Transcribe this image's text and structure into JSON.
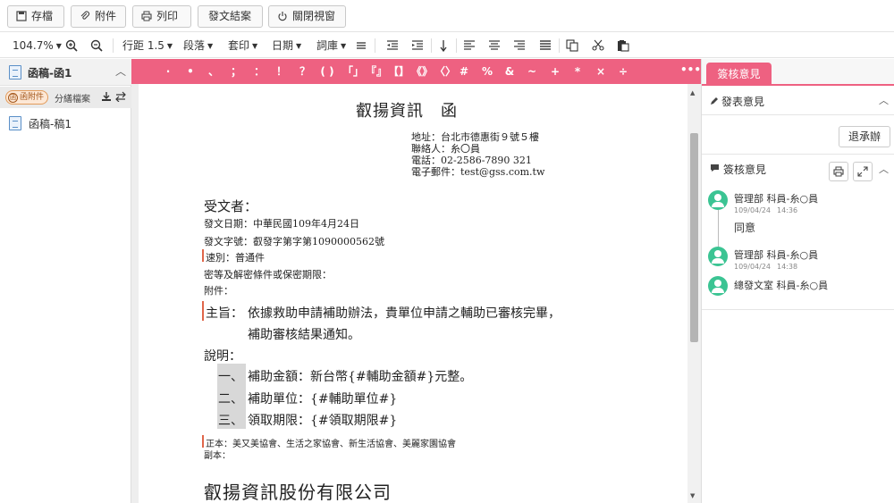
{
  "topbar": {
    "save": "存檔",
    "attach": "附件",
    "print": "列印",
    "send_result": "發文結案",
    "close_window": "關閉視窗"
  },
  "toolbar": {
    "zoom": "104.7%",
    "line_spacing": "行距 1.5",
    "paragraph": "段落",
    "template": "套印",
    "date": "日期",
    "phrases": "詞庫"
  },
  "left_panel": {
    "header": "函稿-函1",
    "attachment_badge": "函附件",
    "split_files": "分繕檔案",
    "draft_item": "函稿-稿1"
  },
  "symbols": [
    "·",
    "•",
    "、",
    "；",
    "：",
    "！",
    "？",
    "( )",
    "「」",
    "『』",
    "【】",
    "《》",
    "〈〉",
    "#",
    "%",
    "&",
    "~",
    "+",
    "*",
    "×",
    "÷"
  ],
  "document": {
    "title": "叡揚資訊　函",
    "address": "地址：台北市德惠街９號５樓",
    "contact": "聯絡人：糸〇員",
    "phone": "電話：02-2586-7890 321",
    "email": "電子郵件：test@gss.com.tw",
    "recipient": "受文者：",
    "send_date": "發文日期：中華民國109年4月24日",
    "send_number": "發文字號：叡發字第字第1090000562號",
    "speed": "速別：普通件",
    "security": "密等及解密條件或保密期限：",
    "attachment": "附件：",
    "subject_label": "主旨：",
    "subject_line1": "依據救助申請補助辦法，貴單位申請之輔助已審核完畢，",
    "subject_line2": "補助審核結果通知。",
    "explain_label": "說明：",
    "items": [
      {
        "num": "一、",
        "text": "補助金額：新台幣{#輔助金額#}元整。"
      },
      {
        "num": "二、",
        "text": "補助單位：{#輔助單位#}"
      },
      {
        "num": "三、",
        "text": "領取期限：{#領取期限#}"
      }
    ],
    "original_copy": "正本：美又美協會、生活之家協會、新生活協會、美麗家園協會",
    "carbon_copy": "副本：",
    "signature": "叡揚資訊股份有限公司"
  },
  "right_panel": {
    "tab": "簽核意見",
    "publish_section": "發表意見",
    "return_button": "退承辦",
    "review_section": "簽核意見",
    "comments": [
      {
        "dept": "管理部 科員-糸○員",
        "date": "109/04/24",
        "time": "14:36",
        "text": "同意"
      },
      {
        "dept": "管理部 科員-糸○員",
        "date": "109/04/24",
        "time": "14:38",
        "text": ""
      },
      {
        "dept": "總發文室 科員-糸○員",
        "date": "",
        "time": "",
        "text": ""
      }
    ]
  },
  "colors": {
    "accent": "#ee6181",
    "avatar": "#3bc493",
    "red_mark": "#e0664a"
  }
}
